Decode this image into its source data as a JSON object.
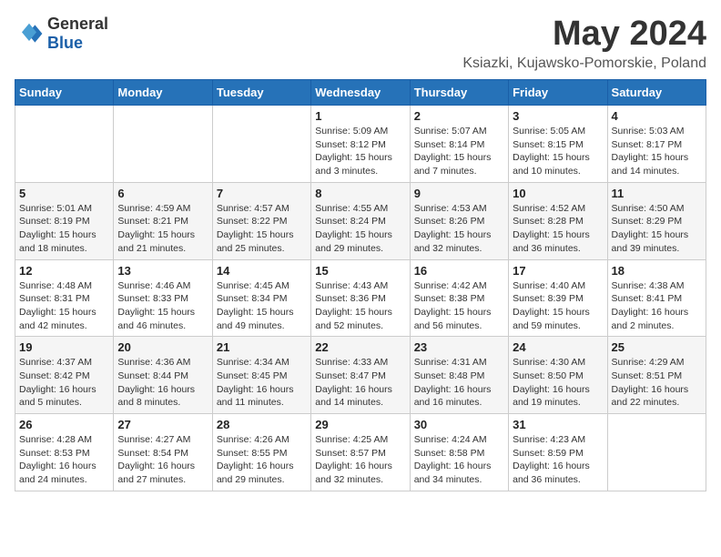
{
  "header": {
    "logo_general": "General",
    "logo_blue": "Blue",
    "month_title": "May 2024",
    "location": "Ksiazki, Kujawsko-Pomorskie, Poland"
  },
  "days_of_week": [
    "Sunday",
    "Monday",
    "Tuesday",
    "Wednesday",
    "Thursday",
    "Friday",
    "Saturday"
  ],
  "weeks": [
    [
      {
        "day": "",
        "info": ""
      },
      {
        "day": "",
        "info": ""
      },
      {
        "day": "",
        "info": ""
      },
      {
        "day": "1",
        "info": "Sunrise: 5:09 AM\nSunset: 8:12 PM\nDaylight: 15 hours\nand 3 minutes."
      },
      {
        "day": "2",
        "info": "Sunrise: 5:07 AM\nSunset: 8:14 PM\nDaylight: 15 hours\nand 7 minutes."
      },
      {
        "day": "3",
        "info": "Sunrise: 5:05 AM\nSunset: 8:15 PM\nDaylight: 15 hours\nand 10 minutes."
      },
      {
        "day": "4",
        "info": "Sunrise: 5:03 AM\nSunset: 8:17 PM\nDaylight: 15 hours\nand 14 minutes."
      }
    ],
    [
      {
        "day": "5",
        "info": "Sunrise: 5:01 AM\nSunset: 8:19 PM\nDaylight: 15 hours\nand 18 minutes."
      },
      {
        "day": "6",
        "info": "Sunrise: 4:59 AM\nSunset: 8:21 PM\nDaylight: 15 hours\nand 21 minutes."
      },
      {
        "day": "7",
        "info": "Sunrise: 4:57 AM\nSunset: 8:22 PM\nDaylight: 15 hours\nand 25 minutes."
      },
      {
        "day": "8",
        "info": "Sunrise: 4:55 AM\nSunset: 8:24 PM\nDaylight: 15 hours\nand 29 minutes."
      },
      {
        "day": "9",
        "info": "Sunrise: 4:53 AM\nSunset: 8:26 PM\nDaylight: 15 hours\nand 32 minutes."
      },
      {
        "day": "10",
        "info": "Sunrise: 4:52 AM\nSunset: 8:28 PM\nDaylight: 15 hours\nand 36 minutes."
      },
      {
        "day": "11",
        "info": "Sunrise: 4:50 AM\nSunset: 8:29 PM\nDaylight: 15 hours\nand 39 minutes."
      }
    ],
    [
      {
        "day": "12",
        "info": "Sunrise: 4:48 AM\nSunset: 8:31 PM\nDaylight: 15 hours\nand 42 minutes."
      },
      {
        "day": "13",
        "info": "Sunrise: 4:46 AM\nSunset: 8:33 PM\nDaylight: 15 hours\nand 46 minutes."
      },
      {
        "day": "14",
        "info": "Sunrise: 4:45 AM\nSunset: 8:34 PM\nDaylight: 15 hours\nand 49 minutes."
      },
      {
        "day": "15",
        "info": "Sunrise: 4:43 AM\nSunset: 8:36 PM\nDaylight: 15 hours\nand 52 minutes."
      },
      {
        "day": "16",
        "info": "Sunrise: 4:42 AM\nSunset: 8:38 PM\nDaylight: 15 hours\nand 56 minutes."
      },
      {
        "day": "17",
        "info": "Sunrise: 4:40 AM\nSunset: 8:39 PM\nDaylight: 15 hours\nand 59 minutes."
      },
      {
        "day": "18",
        "info": "Sunrise: 4:38 AM\nSunset: 8:41 PM\nDaylight: 16 hours\nand 2 minutes."
      }
    ],
    [
      {
        "day": "19",
        "info": "Sunrise: 4:37 AM\nSunset: 8:42 PM\nDaylight: 16 hours\nand 5 minutes."
      },
      {
        "day": "20",
        "info": "Sunrise: 4:36 AM\nSunset: 8:44 PM\nDaylight: 16 hours\nand 8 minutes."
      },
      {
        "day": "21",
        "info": "Sunrise: 4:34 AM\nSunset: 8:45 PM\nDaylight: 16 hours\nand 11 minutes."
      },
      {
        "day": "22",
        "info": "Sunrise: 4:33 AM\nSunset: 8:47 PM\nDaylight: 16 hours\nand 14 minutes."
      },
      {
        "day": "23",
        "info": "Sunrise: 4:31 AM\nSunset: 8:48 PM\nDaylight: 16 hours\nand 16 minutes."
      },
      {
        "day": "24",
        "info": "Sunrise: 4:30 AM\nSunset: 8:50 PM\nDaylight: 16 hours\nand 19 minutes."
      },
      {
        "day": "25",
        "info": "Sunrise: 4:29 AM\nSunset: 8:51 PM\nDaylight: 16 hours\nand 22 minutes."
      }
    ],
    [
      {
        "day": "26",
        "info": "Sunrise: 4:28 AM\nSunset: 8:53 PM\nDaylight: 16 hours\nand 24 minutes."
      },
      {
        "day": "27",
        "info": "Sunrise: 4:27 AM\nSunset: 8:54 PM\nDaylight: 16 hours\nand 27 minutes."
      },
      {
        "day": "28",
        "info": "Sunrise: 4:26 AM\nSunset: 8:55 PM\nDaylight: 16 hours\nand 29 minutes."
      },
      {
        "day": "29",
        "info": "Sunrise: 4:25 AM\nSunset: 8:57 PM\nDaylight: 16 hours\nand 32 minutes."
      },
      {
        "day": "30",
        "info": "Sunrise: 4:24 AM\nSunset: 8:58 PM\nDaylight: 16 hours\nand 34 minutes."
      },
      {
        "day": "31",
        "info": "Sunrise: 4:23 AM\nSunset: 8:59 PM\nDaylight: 16 hours\nand 36 minutes."
      },
      {
        "day": "",
        "info": ""
      }
    ]
  ]
}
